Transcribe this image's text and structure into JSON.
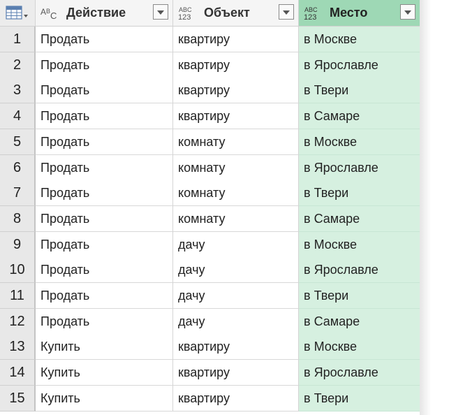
{
  "columns": [
    {
      "type_icon": "ABC",
      "name": "Действие"
    },
    {
      "type_icon": "ABC123",
      "name": "Объект"
    },
    {
      "type_icon": "ABC123",
      "name": "Место"
    }
  ],
  "icons": {
    "corner": "table-menu-icon",
    "filter": "chevron-down-icon"
  },
  "colors": {
    "selected_column_header": "#9ed8b5",
    "selected_column_cells": "#d6f0e0"
  },
  "rows": [
    {
      "n": "1",
      "a": "Продать",
      "b": "квартиру",
      "c": "в Москве"
    },
    {
      "n": "2",
      "a": "Продать",
      "b": "квартиру",
      "c": "в Ярославле"
    },
    {
      "n": "3",
      "a": "Продать",
      "b": "квартиру",
      "c": "в Твери"
    },
    {
      "n": "4",
      "a": "Продать",
      "b": "квартиру",
      "c": "в Самаре"
    },
    {
      "n": "5",
      "a": "Продать",
      "b": "комнату",
      "c": "в Москве"
    },
    {
      "n": "6",
      "a": "Продать",
      "b": "комнату",
      "c": "в Ярославле"
    },
    {
      "n": "7",
      "a": "Продать",
      "b": "комнату",
      "c": "в Твери"
    },
    {
      "n": "8",
      "a": "Продать",
      "b": "комнату",
      "c": "в Самаре"
    },
    {
      "n": "9",
      "a": "Продать",
      "b": "дачу",
      "c": "в Москве"
    },
    {
      "n": "10",
      "a": "Продать",
      "b": "дачу",
      "c": "в Ярославле"
    },
    {
      "n": "11",
      "a": "Продать",
      "b": "дачу",
      "c": "в Твери"
    },
    {
      "n": "12",
      "a": "Продать",
      "b": "дачу",
      "c": "в Самаре"
    },
    {
      "n": "13",
      "a": "Купить",
      "b": "квартиру",
      "c": "в Москве"
    },
    {
      "n": "14",
      "a": "Купить",
      "b": "квартиру",
      "c": "в Ярославле"
    },
    {
      "n": "15",
      "a": "Купить",
      "b": "квартиру",
      "c": "в Твери"
    }
  ]
}
